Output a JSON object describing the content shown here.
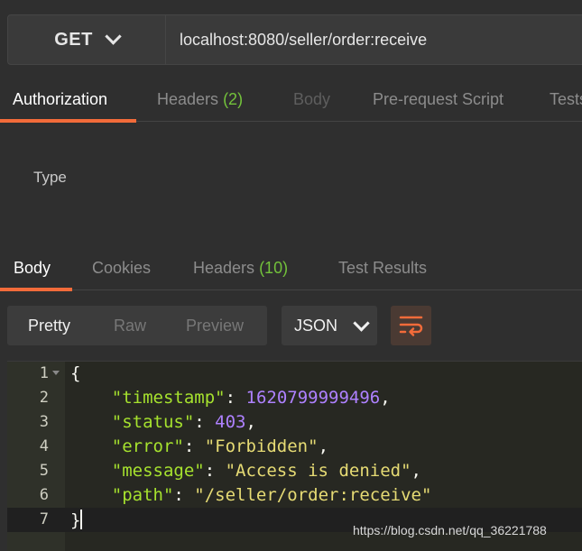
{
  "request": {
    "method": "GET",
    "url": "localhost:8080/seller/order:receive"
  },
  "request_tabs": [
    {
      "label": "Authorization",
      "count": ""
    },
    {
      "label": "Headers",
      "count": "(2)"
    },
    {
      "label": "Body",
      "count": ""
    },
    {
      "label": "Pre-request Script",
      "count": ""
    },
    {
      "label": "Tests",
      "count": ""
    }
  ],
  "authorization": {
    "type_label": "Type"
  },
  "response_tabs": [
    {
      "label": "Body",
      "count": ""
    },
    {
      "label": "Cookies",
      "count": ""
    },
    {
      "label": "Headers",
      "count": "(10)"
    },
    {
      "label": "Test Results",
      "count": ""
    }
  ],
  "view_modes": [
    "Pretty",
    "Raw",
    "Preview"
  ],
  "format": "JSON",
  "editor": {
    "line_numbers": [
      "1",
      "2",
      "3",
      "4",
      "5",
      "6",
      "7"
    ],
    "open_brace": "{",
    "close_brace": "}",
    "fields": [
      {
        "key": "\"timestamp\"",
        "value": "1620799999496",
        "type": "number",
        "comma": ","
      },
      {
        "key": "\"status\"",
        "value": "403",
        "type": "number",
        "comma": ","
      },
      {
        "key": "\"error\"",
        "value": "\"Forbidden\"",
        "type": "string",
        "comma": ","
      },
      {
        "key": "\"message\"",
        "value": "\"Access is denied\"",
        "type": "string",
        "comma": ","
      },
      {
        "key": "\"path\"",
        "value": "\"/seller/order:receive\"",
        "type": "string",
        "comma": ""
      }
    ]
  },
  "watermark": "https://blog.csdn.net/qq_36221788",
  "colors": {
    "accent": "#f26b3a",
    "count": "#73c23b",
    "json_key": "#a6e22e",
    "json_number": "#ae81ff",
    "json_string": "#e6db74"
  }
}
